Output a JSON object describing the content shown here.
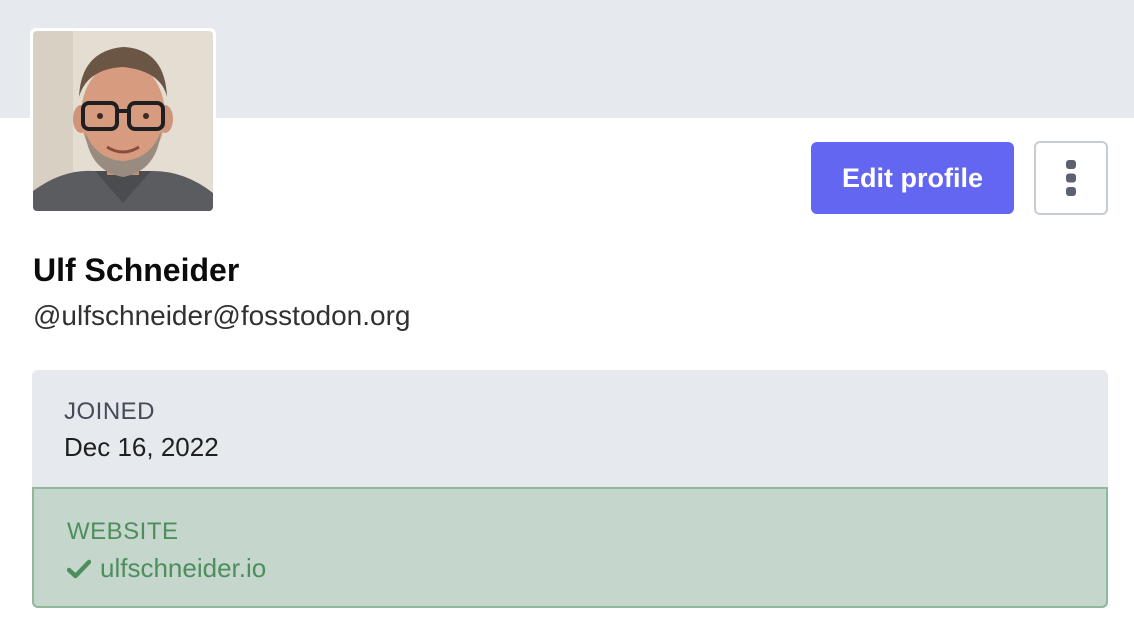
{
  "profile": {
    "display_name": "Ulf Schneider",
    "handle": "@ulfschneider@fosstodon.org",
    "avatar_alt": "Ulf Schneider"
  },
  "actions": {
    "edit_profile_label": "Edit profile",
    "more_icon": "vertical-ellipsis-icon"
  },
  "fields": {
    "joined": {
      "label": "JOINED",
      "value": "Dec 16, 2022"
    },
    "website": {
      "label": "WEBSITE",
      "value": "ulfschneider.io",
      "verified": true,
      "icon": "check-icon"
    }
  },
  "colors": {
    "banner": "#e6e9ee",
    "accent": "#6366f1",
    "verified_green": "#4e8e5c",
    "verified_bg": "#c5d6cd"
  }
}
